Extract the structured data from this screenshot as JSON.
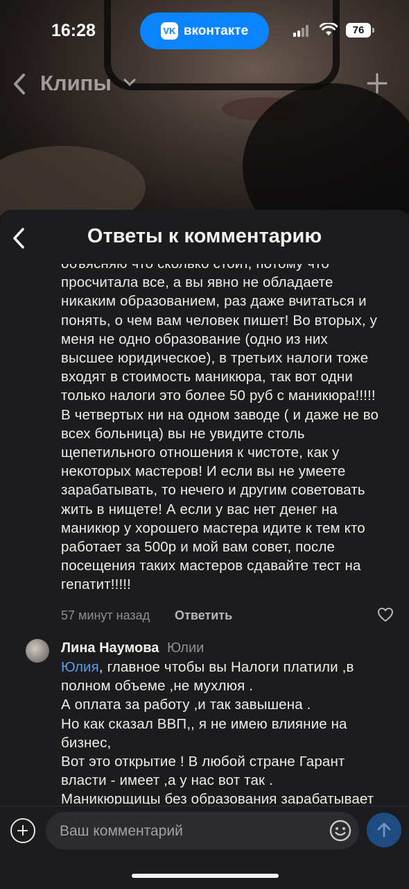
{
  "status_bar": {
    "time": "16:28",
    "app_pill": "вконтакте",
    "app_logo": "VK",
    "battery": "76"
  },
  "clips_header": {
    "title": "Клипы"
  },
  "sheet": {
    "title": "Ответы к комментарию"
  },
  "comments": [
    {
      "text": "объясняю что сколько стоит, потому что\nпросчитала все, а вы явно не обладаете\nникаким образованием, раз даже вчитаться и\nпонять, о чем вам человек пишет! Во вторых, у\nменя не одно образование (одно из них\nвысшее юридическое), в третьих налоги тоже\nвходят в стоимость маникюра, так вот одни\nтолько налоги это более 50 руб с маникюра!!!!!\nВ четвертых ни на одном заводе ( и даже не во\nвсех больница) вы не увидите столь\nщепетильного отношения к чистоте, как у\nнекоторых мастеров! И если вы не умеете\nзарабатывать, то нечего и другим советовать\nжить в нищете! А если у вас нет денег на\nманикюр у хорошего мастера идите к тем кто\nработает за 500р и мой вам совет, после\nпосещения таких мастеров сдавайте тест на\nгепатит!!!!!",
      "time": "57 минут назад",
      "reply_label": "Ответить"
    },
    {
      "author": "Лина Наумова",
      "reply_to": "Юлии",
      "mention": "Юлия",
      "text": ", главное чтобы вы  Налоги платили ,в\nполном объеме ,не мухлюя .\nА оплата за работу ,и так завышена .\nНо как сказал ВВП,, я не имею влияние на\nбизнес,\nВот это открытие ! В любой стране Гарант\nвласти - имеет ,а у нас вот так .\nМаникюрщицы без образования зарабатывает"
    }
  ],
  "composer": {
    "placeholder": "Ваш комментарий"
  },
  "icons": {
    "back": "chevron-left-icon",
    "dropdown": "chevron-down-icon",
    "add": "plus-icon",
    "like": "heart-icon",
    "scroll": "chevron-down-icon",
    "emoji": "smiley-icon",
    "send": "arrow-up-icon"
  },
  "colors": {
    "accent": "#0a84ff",
    "mention": "#5b9ce6",
    "sheet_bg": "#1c1c1e",
    "send_bg": "#1e4b80"
  }
}
